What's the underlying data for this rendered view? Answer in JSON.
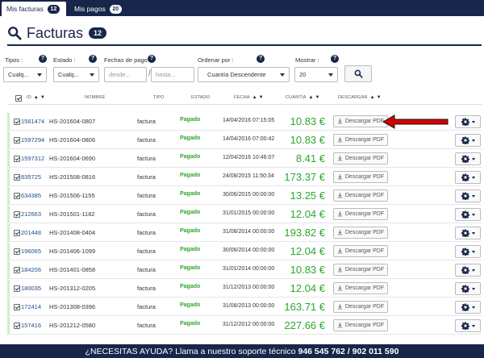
{
  "tabs": [
    {
      "label": "Mis facturas",
      "count": "12"
    },
    {
      "label": "Mis pagos",
      "count": "20"
    }
  ],
  "page": {
    "title": "Facturas",
    "count": "12"
  },
  "filters": {
    "tipos": {
      "label": "Tipos :",
      "value": "Cualq..."
    },
    "estado": {
      "label": "Estado :",
      "value": "Cualq..."
    },
    "fechas": {
      "label": "Fechas de pago :",
      "from_placeholder": "desde...",
      "to_placeholder": "hasta..."
    },
    "ordenar": {
      "label": "Ordenar por :",
      "value": "Cuantía Descendente"
    },
    "mostrar": {
      "label": "Mostrar :",
      "value": "20"
    }
  },
  "columns": {
    "id": "ID",
    "nombre": "NOMBRE",
    "tipo": "TIPO",
    "estado": "ESTADO",
    "fecha": "FECHA",
    "cuantia": "CUANTÍA",
    "descargar": "DESCARGAR"
  },
  "download_label": "Descargar PDF",
  "rows": [
    {
      "id": "1561474",
      "nombre": "HS-201604-0807",
      "tipo": "factura",
      "estado": "Pagado",
      "fecha": "14/04/2016 07:15:05",
      "cantidad": "10.83 €"
    },
    {
      "id": "1597294",
      "nombre": "HS-201604-0806",
      "tipo": "factura",
      "estado": "Pagado",
      "fecha": "14/04/2016 07:00:42",
      "cantidad": "10.83 €"
    },
    {
      "id": "1597312",
      "nombre": "HS-201604-0690",
      "tipo": "factura",
      "estado": "Pagado",
      "fecha": "12/04/2016 10:46:07",
      "cantidad": "8.41 €"
    },
    {
      "id": "835725",
      "nombre": "HS-201508-0816",
      "tipo": "factura",
      "estado": "Pagado",
      "fecha": "24/08/2015 11:50:34",
      "cantidad": "173.37 €"
    },
    {
      "id": "634385",
      "nombre": "HS-201506-1155",
      "tipo": "factura",
      "estado": "Pagado",
      "fecha": "30/06/2015 00:00:00",
      "cantidad": "13.25 €"
    },
    {
      "id": "212663",
      "nombre": "HS-201501-1182",
      "tipo": "factura",
      "estado": "Pagado",
      "fecha": "31/01/2015 00:00:00",
      "cantidad": "12.04 €"
    },
    {
      "id": "201448",
      "nombre": "HS-201408-0404",
      "tipo": "factura",
      "estado": "Pagado",
      "fecha": "31/08/2014 00:00:00",
      "cantidad": "193.82 €"
    },
    {
      "id": "196065",
      "nombre": "HS-201406-1099",
      "tipo": "factura",
      "estado": "Pagado",
      "fecha": "30/06/2014 00:00:00",
      "cantidad": "12.04 €"
    },
    {
      "id": "184206",
      "nombre": "HS-201401-0858",
      "tipo": "factura",
      "estado": "Pagado",
      "fecha": "31/01/2014 00:00:00",
      "cantidad": "10.83 €"
    },
    {
      "id": "180035",
      "nombre": "HS-201312-0205",
      "tipo": "factura",
      "estado": "Pagado",
      "fecha": "31/12/2013 00:00:00",
      "cantidad": "12.04 €"
    },
    {
      "id": "172414",
      "nombre": "HS-201308-0396",
      "tipo": "factura",
      "estado": "Pagado",
      "fecha": "31/08/2013 00:00:00",
      "cantidad": "163.71 €"
    },
    {
      "id": "157416",
      "nombre": "HS-201212-0580",
      "tipo": "factura",
      "estado": "Pagado",
      "fecha": "31/12/2012 00:00:00",
      "cantidad": "227.66 €"
    }
  ],
  "footer": {
    "text": "¿NECESITAS AYUDA? Llama a nuestro soporte técnico",
    "phones": "946 545 762 / 902 011 590"
  },
  "colors": {
    "navy": "#17264a",
    "paid_green": "#2ea62e",
    "link_blue": "#1f4c8c",
    "annotation_red": "#d40000"
  }
}
